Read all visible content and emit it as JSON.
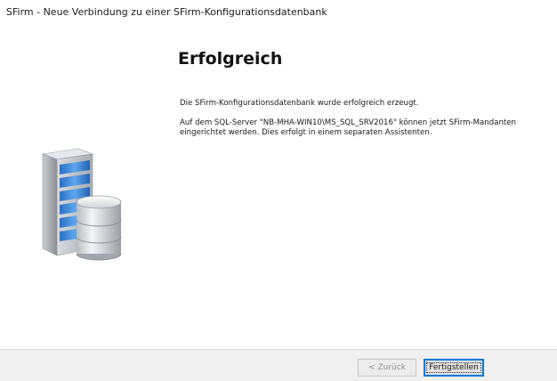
{
  "window": {
    "title": "SFirm - Neue Verbindung zu einer SFirm-Konfigurationsdatenbank"
  },
  "main": {
    "heading": "Erfolgreich",
    "message_success": "Die SFirm-Konfigurationsdatenbank wurde erfolgreich erzeugt.",
    "message_detail": "Auf dem SQL-Server \"NB-MHA-WIN10\\MS_SQL_SRV2016\" können jetzt SFirm-Mandanten eingerichtet werden. Dies erfolgt in einem separaten Assistenten.",
    "illustration_icon": "server-database-icon"
  },
  "footer": {
    "back_label": "< Zurück",
    "finish_label": "Fertigstellen"
  },
  "colors": {
    "footer_bg": "#f0f0f0",
    "focus_border": "#0078d7",
    "server_blue": "#2f7fd4"
  }
}
